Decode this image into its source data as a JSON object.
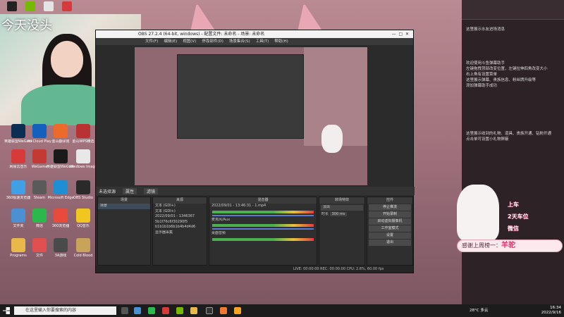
{
  "webcam": {
    "title": "今天没头"
  },
  "desktop_icons": [
    {
      "label": "英雄联盟WeGame",
      "color": "#0c2e52"
    },
    {
      "label": "MI Cloud Play",
      "color": "#1560bd"
    },
    {
      "label": "金山翻译官",
      "color": "#ec6b2a"
    },
    {
      "label": "金山WPS精选",
      "color": "#b83232"
    },
    {
      "label": "网易云音乐",
      "color": "#d63a3a"
    },
    {
      "label": "WeGame",
      "color": "#c23a33"
    },
    {
      "label": "英雄联盟WeGame版",
      "color": "#1a1a1a"
    },
    {
      "label": "Windows Image",
      "color": "#e8e8e8"
    },
    {
      "label": "360极速浏览器",
      "color": "#3fa0e6"
    },
    {
      "label": "Steam",
      "color": "#5a5a5a"
    },
    {
      "label": "Microsoft Edge",
      "color": "#1f8fd4"
    },
    {
      "label": "OBS Studio",
      "color": "#2a2a2a"
    },
    {
      "label": "文件夹",
      "color": "#4b90d0"
    },
    {
      "label": "微信",
      "color": "#2db84e"
    },
    {
      "label": "360浏览器",
      "color": "#e84b3c"
    },
    {
      "label": "QQ音乐",
      "color": "#f0c61f"
    },
    {
      "label": "Programs",
      "color": "#e8b84a"
    },
    {
      "label": "文件",
      "color": "#e05050"
    },
    {
      "label": "3A游戏",
      "color": "#4a4a4a"
    },
    {
      "label": "Cold Blood",
      "color": "#caa35a"
    }
  ],
  "obs": {
    "title": "OBS 27.2.4 (64-bit, windows) - 配置文件: 未命名 - 场景: 未命名",
    "menu": [
      "文件(F)",
      "编辑(E)",
      "视图(V)",
      "停靠部件(D)",
      "场景集合(S)",
      "工具(T)",
      "帮助(H)"
    ],
    "toolbar": [
      "属性",
      "滤镜"
    ],
    "no_source": "未选择源",
    "panels": {
      "scenes": {
        "title": "场景",
        "items": [
          "场景"
        ]
      },
      "sources": {
        "title": "来源",
        "items": [
          "文本 (GDI+)",
          "文本 (GDI+)",
          "2022/09/01 - 1346367",
          "5b1f76c6f30290f5",
          "b1b1b1b6b1b4b4d4d6",
          "显示器采集"
        ]
      },
      "mixer": {
        "title": "混音器",
        "items": [
          "2022/09/01 - 13:46:31 - 1.mp4",
          "麦克风/Aux",
          "桌面音频"
        ]
      },
      "transitions": {
        "title": "转场特效",
        "type": "淡出",
        "duration_label": "时长",
        "duration": "300 ms"
      },
      "controls": {
        "title": "控件",
        "buttons": [
          "停止推流",
          "开始录制",
          "启动虚拟摄像机",
          "工作室模式",
          "设置",
          "退出"
        ]
      }
    },
    "status": "LIVE: 00:00:00   REC: 00:00:00   CPU: 2.6%, 60.00 fps"
  },
  "chat": {
    "lines": [
      "这里展示水友进场消息",
      "欢迎使用斗鱼弹幕助手",
      "左键拖拽顶部改变位置，左键拉伸四角改变大小",
      "右上角有设置菜单",
      "这里展示弹幕、贵族信息、粉丝牌升级等",
      "添加弹幕助手成功",
      "这里展示收到的礼物、道具、贵族开通、钻粉开通",
      "点击单可设置小礼物屏蔽"
    ],
    "gift_labels": [
      "上车",
      "2天车位",
      "微信"
    ],
    "banner_prefix": "感谢上周榜一：",
    "banner_name": "羊驼"
  },
  "taskbar": {
    "search_placeholder": "在这里输入你要搜索的内容",
    "weather": "28°C 多云",
    "time": "16:34",
    "date": "2022/9/16"
  },
  "colors": {
    "accent": "#d9386c",
    "obs_bg": "#2b2b2b"
  }
}
